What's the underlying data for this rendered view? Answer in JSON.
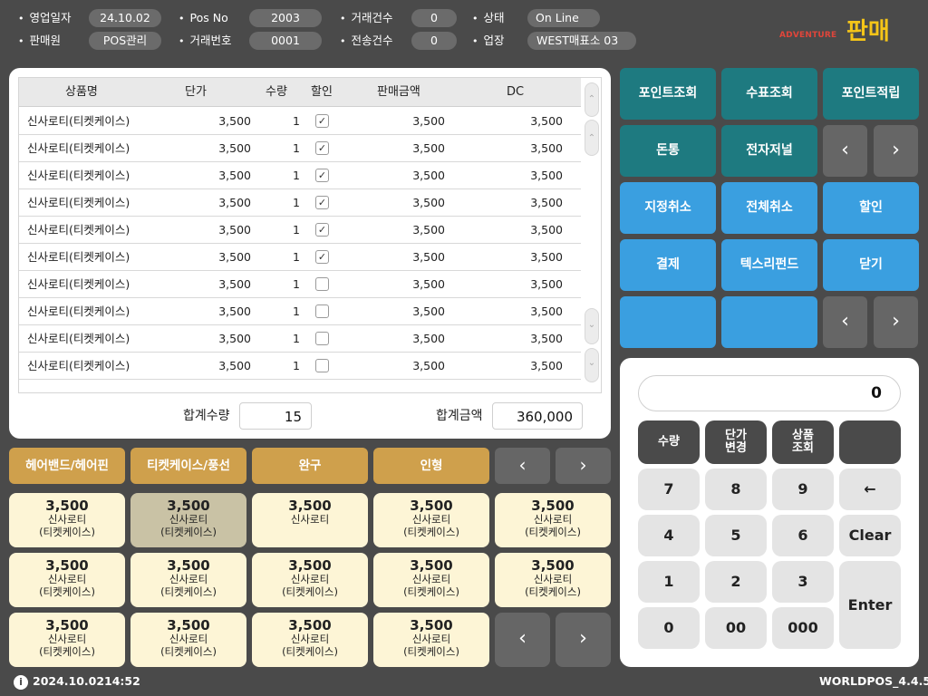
{
  "header": {
    "fields": [
      {
        "label": "영업일자",
        "value": "24.10.02"
      },
      {
        "label": "판매원",
        "value": "POS관리"
      },
      {
        "label": "Pos  No",
        "value": "2003"
      },
      {
        "label": "거래번호",
        "value": "0001"
      },
      {
        "label": "거래건수",
        "value": "0"
      },
      {
        "label": "전송건수",
        "value": "0"
      },
      {
        "label": "상태",
        "value": "On Line"
      },
      {
        "label": "업장",
        "value": "WEST매표소  03"
      }
    ],
    "brand_sub": "ADVENTURE",
    "brand_main": "판매"
  },
  "table": {
    "columns": [
      "상품명",
      "단가",
      "수량",
      "할인",
      "판매금액",
      "DC"
    ],
    "rows": [
      {
        "name": "신사로티(티켓케이스)",
        "price": "3,500",
        "qty": "1",
        "disc": "✓",
        "amount": "3,500",
        "dc": "3,500"
      },
      {
        "name": "신사로티(티켓케이스)",
        "price": "3,500",
        "qty": "1",
        "disc": "✓",
        "amount": "3,500",
        "dc": "3,500"
      },
      {
        "name": "신사로티(티켓케이스)",
        "price": "3,500",
        "qty": "1",
        "disc": "✓",
        "amount": "3,500",
        "dc": "3,500"
      },
      {
        "name": "신사로티(티켓케이스)",
        "price": "3,500",
        "qty": "1",
        "disc": "✓",
        "amount": "3,500",
        "dc": "3,500"
      },
      {
        "name": "신사로티(티켓케이스)",
        "price": "3,500",
        "qty": "1",
        "disc": "✓",
        "amount": "3,500",
        "dc": "3,500"
      },
      {
        "name": "신사로티(티켓케이스)",
        "price": "3,500",
        "qty": "1",
        "disc": "✓",
        "amount": "3,500",
        "dc": "3,500"
      },
      {
        "name": "신사로티(티켓케이스)",
        "price": "3,500",
        "qty": "1",
        "disc": "",
        "amount": "3,500",
        "dc": "3,500"
      },
      {
        "name": "신사로티(티켓케이스)",
        "price": "3,500",
        "qty": "1",
        "disc": "",
        "amount": "3,500",
        "dc": "3,500"
      },
      {
        "name": "신사로티(티켓케이스)",
        "price": "3,500",
        "qty": "1",
        "disc": "",
        "amount": "3,500",
        "dc": "3,500"
      },
      {
        "name": "신사로티(티켓케이스)",
        "price": "3,500",
        "qty": "1",
        "disc": "",
        "amount": "3,500",
        "dc": "3,500"
      }
    ],
    "total_qty_label": "합계수량",
    "total_qty": "15",
    "total_amount_label": "합계금액",
    "total_amount": "360,000"
  },
  "functions": {
    "row1": [
      "포인트조회",
      "수표조회",
      "포인트적립"
    ],
    "row2": [
      "돈통",
      "전자저널"
    ],
    "row3": [
      "지정취소",
      "전체취소",
      "할인"
    ],
    "row4": [
      "결제",
      "텍스리펀드",
      "닫기"
    ],
    "prev": "‹",
    "next": "›"
  },
  "keypad": {
    "display": "0",
    "fn": [
      "수량",
      "단가\n변경",
      "상품\n조회",
      ""
    ],
    "keys": [
      "7",
      "8",
      "9",
      "←",
      "4",
      "5",
      "6",
      "Clear",
      "1",
      "2",
      "3",
      "0",
      "00",
      "000"
    ],
    "enter": "Enter"
  },
  "categories": [
    "헤어밴드/헤어핀",
    "티켓케이스/풍선",
    "완구",
    "인형"
  ],
  "products": [
    {
      "price": "3,500",
      "name": "신사로티",
      "sub": "(티켓케이스)"
    },
    {
      "price": "3,500",
      "name": "신사로티",
      "sub": "(티켓케이스)"
    },
    {
      "price": "3,500",
      "name": "신사로티",
      "sub": ""
    },
    {
      "price": "3,500",
      "name": "신사로티",
      "sub": "(티켓케이스)"
    },
    {
      "price": "3,500",
      "name": "신사로티",
      "sub": "(티켓케이스)"
    },
    {
      "price": "3,500",
      "name": "신사로티",
      "sub": "(티켓케이스)"
    },
    {
      "price": "3,500",
      "name": "신사로티",
      "sub": "(티켓케이스)"
    },
    {
      "price": "3,500",
      "name": "신사로티",
      "sub": "(티켓케이스)"
    },
    {
      "price": "3,500",
      "name": "신사로티",
      "sub": "(티켓케이스)"
    },
    {
      "price": "3,500",
      "name": "신사로티",
      "sub": "(티켓케이스)"
    },
    {
      "price": "3,500",
      "name": "신사로티",
      "sub": "(티켓케이스)"
    },
    {
      "price": "3,500",
      "name": "신사로티",
      "sub": "(티켓케이스)"
    },
    {
      "price": "3,500",
      "name": "신사로티",
      "sub": "(티켓케이스)"
    },
    {
      "price": "3,500",
      "name": "신사로티",
      "sub": "(티켓케이스)"
    }
  ],
  "footer": {
    "date": "2024.10.02",
    "time": "14:52",
    "version": "WORLDPOS_4.4.5"
  },
  "colors": {
    "background": "#4a4a4a",
    "teal": "#1e7a80",
    "blue": "#3a9fe0",
    "gold": "#cfa04c",
    "tile": "#fdf5d6",
    "brand_yellow": "#f5c518",
    "brand_red": "#e0453a"
  },
  "icons": {
    "info": "info-icon",
    "prev": "chevron-left-icon",
    "next": "chevron-right-icon",
    "backspace": "arrow-left-icon"
  }
}
